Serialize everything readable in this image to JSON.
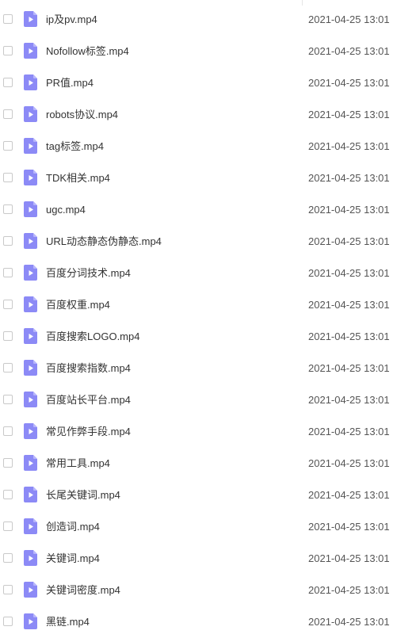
{
  "colors": {
    "icon_fill": "#8c8af6",
    "icon_fold": "#b8b6fb",
    "text": "#333333",
    "date_text": "#555555",
    "checkbox_border": "#c9c9c9"
  },
  "file_icon": "video-file-icon",
  "files": [
    {
      "name": "ip及pv.mp4",
      "modified": "2021-04-25 13:01"
    },
    {
      "name": "Nofollow标签.mp4",
      "modified": "2021-04-25 13:01"
    },
    {
      "name": "PR值.mp4",
      "modified": "2021-04-25 13:01"
    },
    {
      "name": "robots协议.mp4",
      "modified": "2021-04-25 13:01"
    },
    {
      "name": "tag标签.mp4",
      "modified": "2021-04-25 13:01"
    },
    {
      "name": "TDK相关.mp4",
      "modified": "2021-04-25 13:01"
    },
    {
      "name": "ugc.mp4",
      "modified": "2021-04-25 13:01"
    },
    {
      "name": "URL动态静态伪静态.mp4",
      "modified": "2021-04-25 13:01"
    },
    {
      "name": "百度分词技术.mp4",
      "modified": "2021-04-25 13:01"
    },
    {
      "name": "百度权重.mp4",
      "modified": "2021-04-25 13:01"
    },
    {
      "name": "百度搜索LOGO.mp4",
      "modified": "2021-04-25 13:01"
    },
    {
      "name": "百度搜索指数.mp4",
      "modified": "2021-04-25 13:01"
    },
    {
      "name": "百度站长平台.mp4",
      "modified": "2021-04-25 13:01"
    },
    {
      "name": "常见作弊手段.mp4",
      "modified": "2021-04-25 13:01"
    },
    {
      "name": "常用工具.mp4",
      "modified": "2021-04-25 13:01"
    },
    {
      "name": "长尾关键词.mp4",
      "modified": "2021-04-25 13:01"
    },
    {
      "name": "创造词.mp4",
      "modified": "2021-04-25 13:01"
    },
    {
      "name": "关键词.mp4",
      "modified": "2021-04-25 13:01"
    },
    {
      "name": "关键词密度.mp4",
      "modified": "2021-04-25 13:01"
    },
    {
      "name": "黑链.mp4",
      "modified": "2021-04-25 13:01"
    }
  ]
}
